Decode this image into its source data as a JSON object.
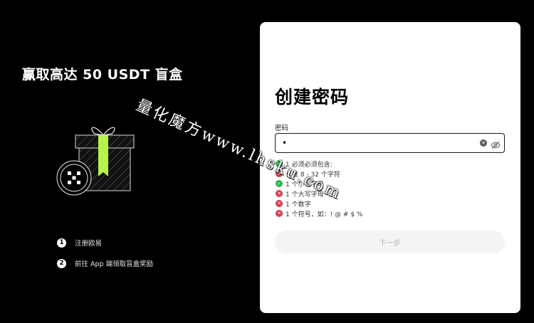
{
  "promo": {
    "title": "赢取高达 50 USDT 盲盒"
  },
  "steps": [
    {
      "num": "1",
      "label": "注册欧易"
    },
    {
      "num": "2",
      "label": "前往 App 端领取盲盒奖励"
    }
  ],
  "form": {
    "title": "创建密码",
    "password_label": "密码",
    "password_value": "•",
    "requirements": [
      {
        "text": "1 必须必须包含:",
        "status": "ok"
      },
      {
        "text": "长度 8 - 32 个字符",
        "status": "fail"
      },
      {
        "text": "1 个小写字母",
        "status": "ok"
      },
      {
        "text": "1 个大写字母",
        "status": "fail"
      },
      {
        "text": "1 个数字",
        "status": "fail"
      },
      {
        "text": "1 个符号，如：! @ # $ %",
        "status": "fail"
      }
    ],
    "next_label": "下一步"
  },
  "watermark": {
    "text": "量化魔方www.lhsku.com"
  },
  "colors": {
    "ok": "#2bb24c",
    "fail": "#d8384c",
    "accent": "#b6f24a"
  },
  "icons": {
    "clear": "clear-icon",
    "eye": "eye-off-icon",
    "logo": "okx-logo-icon"
  }
}
